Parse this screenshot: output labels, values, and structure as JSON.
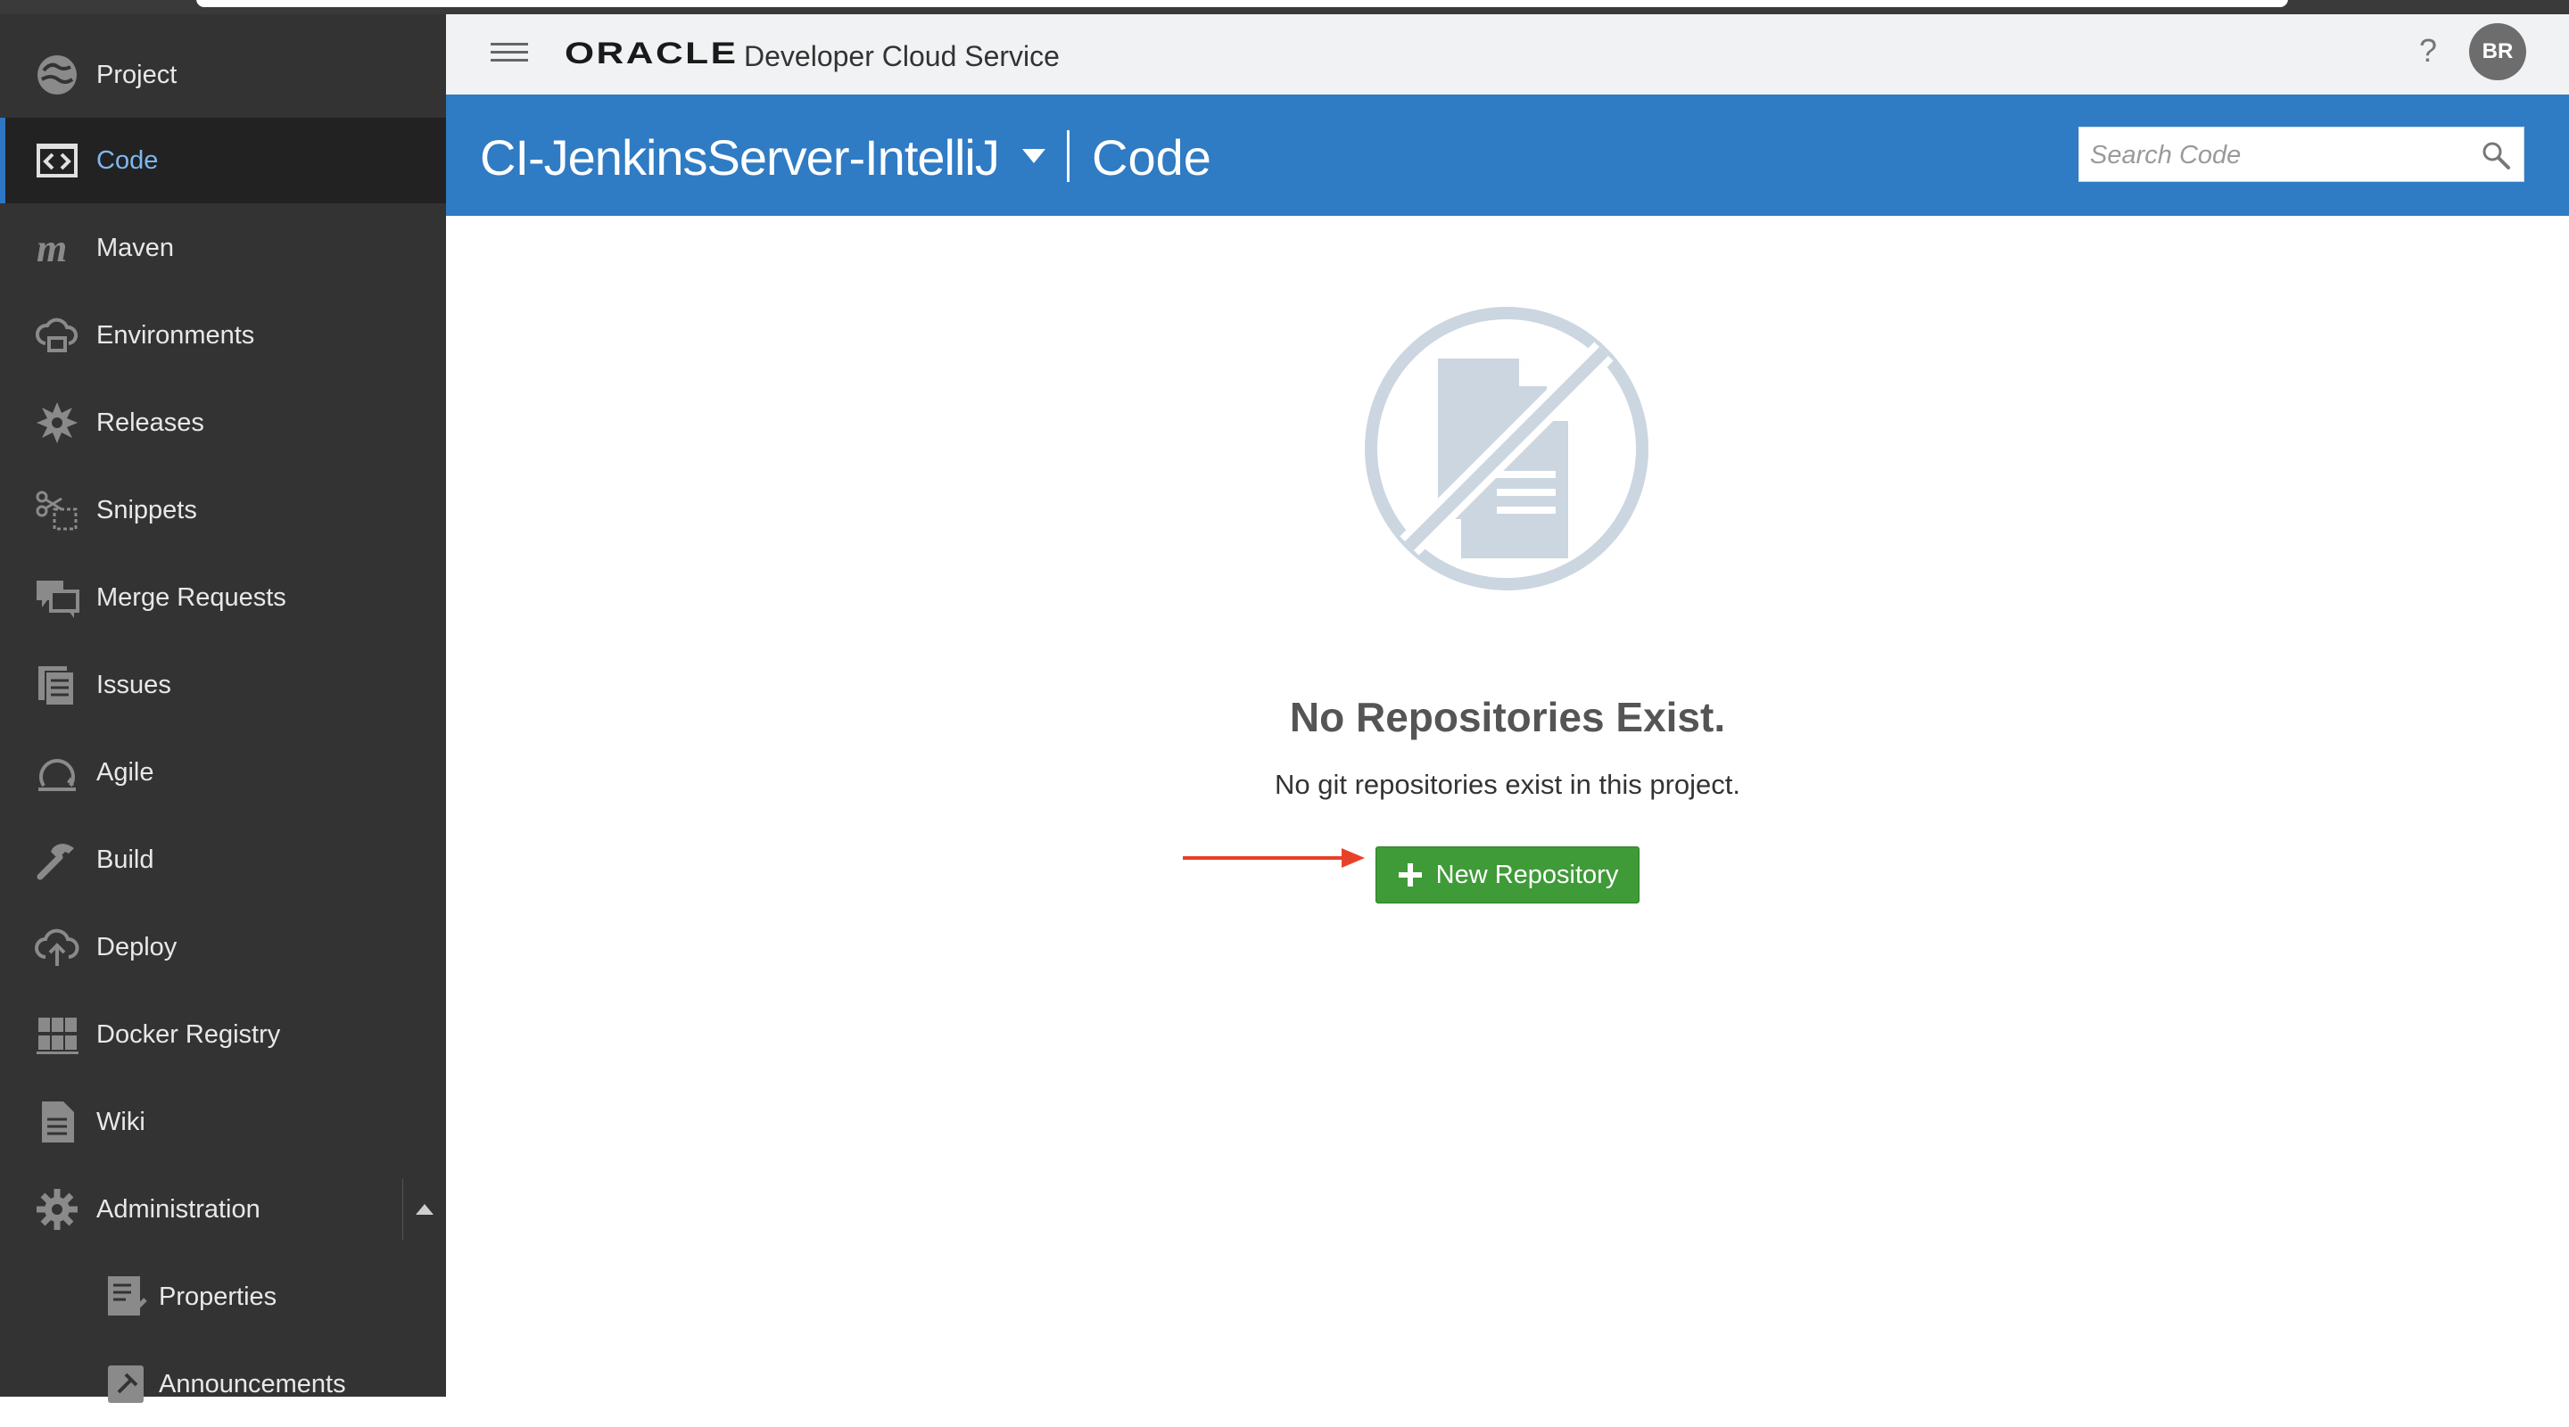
{
  "header": {
    "brand": "ORACLE",
    "service": "Developer Cloud Service",
    "help": "?",
    "avatar_initials": "BR"
  },
  "project_bar": {
    "project_name": "CI-JenkinsServer-IntelliJ",
    "section": "Code",
    "search_placeholder": "Search Code"
  },
  "sidebar": {
    "items": [
      {
        "label": "Project",
        "icon": "project-icon"
      },
      {
        "label": "Code",
        "icon": "code-icon",
        "active": true
      },
      {
        "label": "Maven",
        "icon": "maven-icon"
      },
      {
        "label": "Environments",
        "icon": "environments-icon"
      },
      {
        "label": "Releases",
        "icon": "releases-icon"
      },
      {
        "label": "Snippets",
        "icon": "snippets-icon"
      },
      {
        "label": "Merge Requests",
        "icon": "merge-requests-icon"
      },
      {
        "label": "Issues",
        "icon": "issues-icon"
      },
      {
        "label": "Agile",
        "icon": "agile-icon"
      },
      {
        "label": "Build",
        "icon": "build-icon"
      },
      {
        "label": "Deploy",
        "icon": "deploy-icon"
      },
      {
        "label": "Docker Registry",
        "icon": "docker-registry-icon"
      },
      {
        "label": "Wiki",
        "icon": "wiki-icon"
      },
      {
        "label": "Administration",
        "icon": "administration-icon"
      }
    ],
    "sub_items": [
      {
        "label": "Properties",
        "icon": "properties-icon"
      },
      {
        "label": "Announcements",
        "icon": "announcements-icon"
      }
    ]
  },
  "empty_state": {
    "title": "No Repositories Exist.",
    "description": "No git repositories exist in this project.",
    "button_label": "New Repository"
  },
  "colors": {
    "sidebar_bg": "#333333",
    "accent_blue": "#2f7bc4",
    "button_green": "#3f9a38",
    "arrow_red": "#e8412a"
  }
}
